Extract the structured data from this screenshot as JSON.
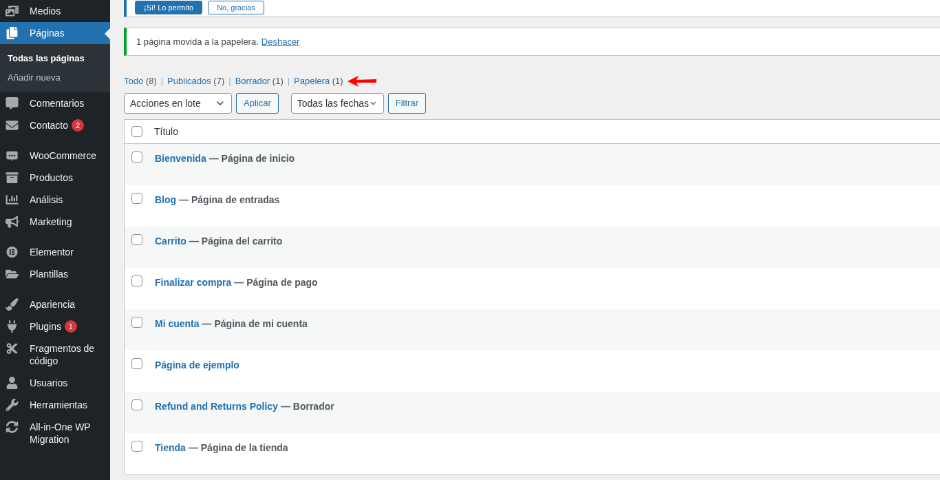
{
  "sidebar": {
    "items": [
      {
        "label": "Medios",
        "selected": false
      },
      {
        "label": "Páginas",
        "selected": true,
        "children": [
          {
            "label": "Todas las páginas",
            "selected": true
          },
          {
            "label": "Añadir nueva",
            "selected": false
          }
        ]
      },
      {
        "label": "Comentarios",
        "selected": false
      },
      {
        "label": "Contacto",
        "selected": false,
        "badge": "2"
      },
      {
        "kind": "separator"
      },
      {
        "label": "WooCommerce",
        "selected": false
      },
      {
        "label": "Productos",
        "selected": false
      },
      {
        "label": "Análisis",
        "selected": false
      },
      {
        "label": "Marketing",
        "selected": false
      },
      {
        "kind": "separator"
      },
      {
        "label": "Elementor",
        "selected": false
      },
      {
        "label": "Plantillas",
        "selected": false
      },
      {
        "kind": "separator"
      },
      {
        "label": "Apariencia",
        "selected": false
      },
      {
        "label": "Plugins",
        "selected": false,
        "badge": "1"
      },
      {
        "label": "Fragmentos de código",
        "selected": false
      },
      {
        "label": "Usuarios",
        "selected": false
      },
      {
        "label": "Herramientas",
        "selected": false
      },
      {
        "label": "All-in-One WP Migration",
        "selected": false
      }
    ]
  },
  "top_notice": {
    "buttons": [
      "¡Sí! Lo permito",
      "No, gracias"
    ]
  },
  "notice": {
    "message": "1 página movida a la papelera.",
    "link": "Deshacer"
  },
  "views": [
    {
      "label": "Todo",
      "count": "(8)"
    },
    {
      "label": "Publicados",
      "count": "(7)"
    },
    {
      "label": "Borrador",
      "count": "(1)"
    },
    {
      "label": "Papelera",
      "count": "(1)"
    }
  ],
  "views_separator": "|",
  "bulk_actions": {
    "value": "Acciones en lote",
    "apply": "Aplicar"
  },
  "date_filter": {
    "value": "Todas las fechas",
    "filter": "Filtrar"
  },
  "table": {
    "columns": [
      "Título"
    ],
    "select_all_checked": false,
    "rows": [
      {
        "title": "Bienvenida",
        "state": "— Página de inicio",
        "checked": false
      },
      {
        "title": "Blog",
        "state": "— Página de entradas",
        "checked": false
      },
      {
        "title": "Carrito",
        "state": "— Página del carrito",
        "checked": false
      },
      {
        "title": "Finalizar compra",
        "state": "— Página de pago",
        "checked": false
      },
      {
        "title": "Mi cuenta",
        "state": "— Página de mi cuenta",
        "checked": false
      },
      {
        "title": "Página de ejemplo",
        "checked": false
      },
      {
        "title": "Refund and Returns Policy",
        "state": "— Borrador",
        "checked": false
      },
      {
        "title": "Tienda",
        "state": "— Página de la tienda",
        "checked": false
      }
    ]
  }
}
